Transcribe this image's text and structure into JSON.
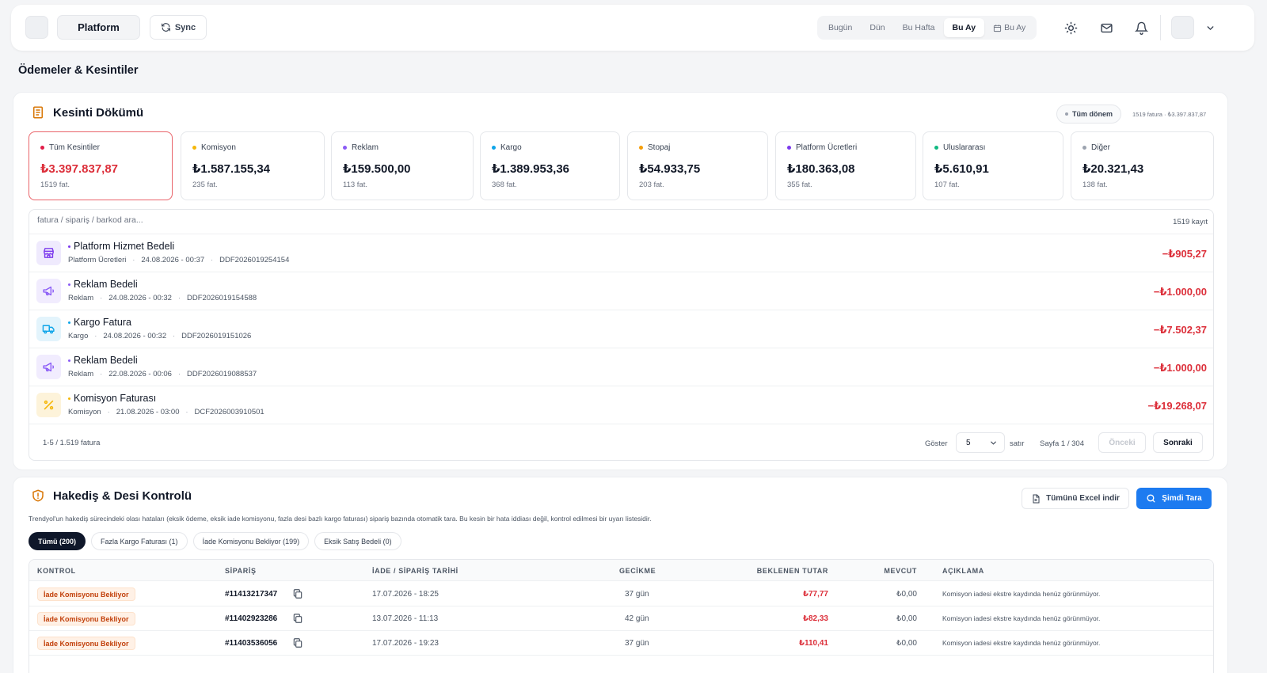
{
  "topbar": {
    "platform_label": "Platform",
    "sync_label": "Sync",
    "periods": [
      "Bugün",
      "Dün",
      "Bu Hafta",
      "Bu Ay",
      "Bu Ay"
    ],
    "active_period": "Bu Ay"
  },
  "page_title": "Ödemeler & Kesintiler",
  "breakdown": {
    "title": "Kesinti Dökümü",
    "period_chip": "Tüm dönem",
    "period_info": "1519 fatura · ₺3.397.837,87",
    "stats": [
      {
        "label": "Tüm Kesintiler",
        "value": "₺3.397.837,87",
        "sub": "1519 fat.",
        "color": "#e11d48"
      },
      {
        "label": "Komisyon",
        "value": "₺1.587.155,34",
        "sub": "235 fat.",
        "color": "#f5b70a"
      },
      {
        "label": "Reklam",
        "value": "₺159.500,00",
        "sub": "113 fat.",
        "color": "#8b5cf6"
      },
      {
        "label": "Kargo",
        "value": "₺1.389.953,36",
        "sub": "368 fat.",
        "color": "#0ea5e9"
      },
      {
        "label": "Stopaj",
        "value": "₺54.933,75",
        "sub": "203 fat.",
        "color": "#f59e0b"
      },
      {
        "label": "Platform Ücretleri",
        "value": "₺180.363,08",
        "sub": "355 fat.",
        "color": "#7c3aed"
      },
      {
        "label": "Uluslararası",
        "value": "₺5.610,91",
        "sub": "107 fat.",
        "color": "#10b981"
      },
      {
        "label": "Diğer",
        "value": "₺20.321,43",
        "sub": "138 fat.",
        "color": "#9ca3af"
      }
    ],
    "search_placeholder": "fatura / sipariş / barkod ara...",
    "record_count": "1519 kayıt",
    "rows": [
      {
        "title": "Platform Hizmet Bedeli",
        "category": "Platform Ücretleri",
        "date": "24.08.2026 - 00:37",
        "doc": "DDF2026019254154",
        "amount": "−₺905,27",
        "icon": "store-icon",
        "color": "#7c3aed",
        "bg": "#efeafd"
      },
      {
        "title": "Reklam Bedeli",
        "category": "Reklam",
        "date": "24.08.2026 - 00:32",
        "doc": "DDF2026019154588",
        "amount": "−₺1.000,00",
        "icon": "megaphone-icon",
        "color": "#8b5cf6",
        "bg": "#f1ecfe"
      },
      {
        "title": "Kargo Fatura",
        "category": "Kargo",
        "date": "24.08.2026 - 00:32",
        "doc": "DDF2026019151026",
        "amount": "−₺7.502,37",
        "icon": "truck-icon",
        "color": "#0ea5e9",
        "bg": "#e3f4fc"
      },
      {
        "title": "Reklam Bedeli",
        "category": "Reklam",
        "date": "22.08.2026 - 00:06",
        "doc": "DDF2026019088537",
        "amount": "−₺1.000,00",
        "icon": "megaphone-icon",
        "color": "#8b5cf6",
        "bg": "#f1ecfe"
      },
      {
        "title": "Komisyon Faturası",
        "category": "Komisyon",
        "date": "21.08.2026 - 03:00",
        "doc": "DCF2026003910501",
        "amount": "−₺19.268,07",
        "icon": "percent-icon",
        "color": "#f5b70a",
        "bg": "#fdf3da"
      }
    ],
    "pager": {
      "range": "1-5 / 1.519 fatura",
      "show_label": "Göster",
      "page_size": "5",
      "rows_label": "satır",
      "page_info": "Sayfa 1 / 304",
      "prev": "Önceki",
      "next": "Sonraki"
    }
  },
  "control": {
    "title": "Hakediş & Desi Kontrolü",
    "description": "Trendyol'un hakediş sürecindeki olası hataları (eksik ödeme, eksik iade komisyonu, fazla desi bazlı kargo faturası) sipariş bazında otomatik tara. Bu kesin bir hata iddiası değil, kontrol edilmesi bir uyarı listesidir.",
    "excel_label": "Tümünü Excel indir",
    "scan_label": "Şimdi Tara",
    "filters": [
      "Tümü (200)",
      "Fazla Kargo Faturası (1)",
      "İade Komisyonu Bekliyor (199)",
      "Eksik Satış Bedeli (0)"
    ],
    "columns": [
      "KONTROL",
      "SİPARİŞ",
      "İADE / SİPARİŞ TARİHİ",
      "GECİKME",
      "BEKLENEN TUTAR",
      "MEVCUT",
      "AÇIKLAMA"
    ],
    "rows": [
      {
        "status": "İade Komisyonu Bekliyor",
        "order": "#11413217347",
        "date": "17.07.2026 - 18:25",
        "delay": "37 gün",
        "expected": "₺77,77",
        "current": "₺0,00",
        "note": "Komisyon iadesi ekstre kaydında henüz görünmüyor."
      },
      {
        "status": "İade Komisyonu Bekliyor",
        "order": "#11402923286",
        "date": "13.07.2026 - 11:13",
        "delay": "42 gün",
        "expected": "₺82,33",
        "current": "₺0,00",
        "note": "Komisyon iadesi ekstre kaydında henüz görünmüyor."
      },
      {
        "status": "İade Komisyonu Bekliyor",
        "order": "#11403536056",
        "date": "17.07.2026 - 19:23",
        "delay": "37 gün",
        "expected": "₺110,41",
        "current": "₺0,00",
        "note": "Komisyon iadesi ekstre kaydında henüz görünmüyor."
      }
    ]
  }
}
